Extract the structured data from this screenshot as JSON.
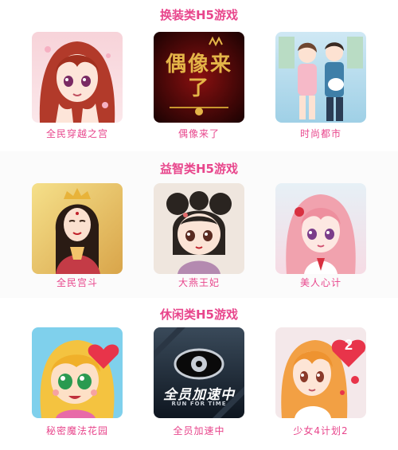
{
  "sections": [
    {
      "title": "换装类H5游戏",
      "games": [
        {
          "label": "全民穿越之宫",
          "icon": "anime-girl-red-hair-icon"
        },
        {
          "label": "偶像来了",
          "icon": "idol-title-icon",
          "cover_text": "偶像来了"
        },
        {
          "label": "时尚都市",
          "icon": "fashion-couple-icon"
        }
      ]
    },
    {
      "title": "益智类H5游戏",
      "games": [
        {
          "label": "全民宫斗",
          "icon": "palace-lady-icon"
        },
        {
          "label": "大燕王妃",
          "icon": "chibi-princess-icon"
        },
        {
          "label": "美人心计",
          "icon": "pink-hair-girl-icon"
        }
      ]
    },
    {
      "title": "休闲类H5游戏",
      "games": [
        {
          "label": "秘密魔法花园",
          "icon": "cartoon-girl-heart-icon"
        },
        {
          "label": "全员加速中",
          "icon": "run-for-time-icon",
          "cover_text": "全员加速中",
          "cover_subtext": "RUN FOR TIME"
        },
        {
          "label": "少女4计划2",
          "icon": "girl-heart-badge-icon",
          "badge": "2"
        }
      ]
    }
  ],
  "colors": {
    "accent": "#e8468c"
  }
}
